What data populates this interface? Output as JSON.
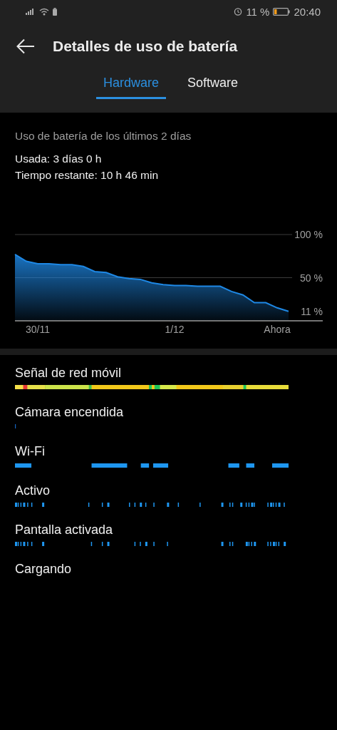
{
  "status_bar": {
    "battery_text": "11 %",
    "time": "20:40"
  },
  "header": {
    "title": "Detalles de uso de batería"
  },
  "tabs": [
    {
      "label": "Hardware",
      "selected": true
    },
    {
      "label": "Software",
      "selected": false
    }
  ],
  "summary": {
    "heading": "Uso de batería de los últimos 2 días",
    "used": "Usada: 3 días 0 h",
    "remaining": "Tiempo restante: 10 h 46 min"
  },
  "chart_data": {
    "type": "area",
    "ylim": [
      0,
      100
    ],
    "categories": [
      null,
      null,
      "30/11",
      null,
      null,
      null,
      null,
      null,
      null,
      null,
      null,
      null,
      null,
      null,
      "1/12",
      null,
      null,
      null,
      null,
      null,
      null,
      null,
      null,
      "Ahora",
      null
    ],
    "yticks": [
      {
        "value": 100,
        "label": "100 %"
      },
      {
        "value": 50,
        "label": "50 %"
      },
      {
        "value": 11,
        "label": "11 %"
      }
    ],
    "series": [
      {
        "color": "#1e88e5",
        "values": [
          77,
          69,
          66,
          66,
          65,
          65,
          63,
          57,
          56,
          51,
          49,
          48,
          44,
          42,
          41,
          41,
          40,
          40,
          40,
          34,
          30,
          21,
          21,
          15,
          11
        ]
      }
    ]
  },
  "timelines": [
    {
      "label": "Señal de red móvil",
      "kind": "signal"
    },
    {
      "label": "Cámara encendida",
      "kind": "sparse"
    },
    {
      "label": "Wi-Fi",
      "kind": "segments"
    },
    {
      "label": "Activo",
      "kind": "ticks"
    },
    {
      "label": "Pantalla activada",
      "kind": "ticks"
    },
    {
      "label": "Cargando",
      "kind": "empty"
    }
  ]
}
